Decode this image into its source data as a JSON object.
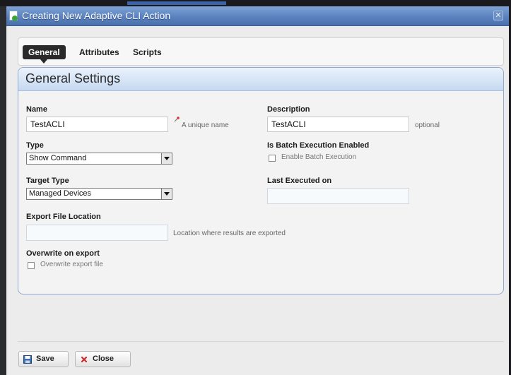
{
  "dialog": {
    "title": "Creating New Adaptive CLI Action",
    "close_glyph": "✕"
  },
  "tabs": [
    {
      "label": "General",
      "active": true
    },
    {
      "label": "Attributes",
      "active": false
    },
    {
      "label": "Scripts",
      "active": false
    }
  ],
  "panel": {
    "title": "General Settings"
  },
  "form": {
    "name": {
      "label": "Name",
      "value": "TestACLI",
      "hint": "A unique name",
      "required_icon": "required-marker-icon"
    },
    "description": {
      "label": "Description",
      "value": "TestACLI",
      "hint": "optional"
    },
    "type": {
      "label": "Type",
      "selected": "Show Command"
    },
    "batch": {
      "label": "Is Batch Execution Enabled",
      "checkbox_label": "Enable Batch Execution",
      "checked": false
    },
    "target_type": {
      "label": "Target Type",
      "selected": "Managed Devices"
    },
    "last_executed": {
      "label": "Last Executed on",
      "value": ""
    },
    "export_location": {
      "label": "Export File Location",
      "value": "",
      "hint": "Location where results are exported"
    },
    "overwrite": {
      "label": "Overwrite on export",
      "checkbox_label": "Overwrite export file",
      "checked": false
    }
  },
  "footer": {
    "save_label": "Save",
    "close_label": "Close"
  },
  "colors": {
    "titlebar": "#5b82bf",
    "panel_border": "#8fa9cf",
    "tab_active": "#2a2a2a"
  }
}
